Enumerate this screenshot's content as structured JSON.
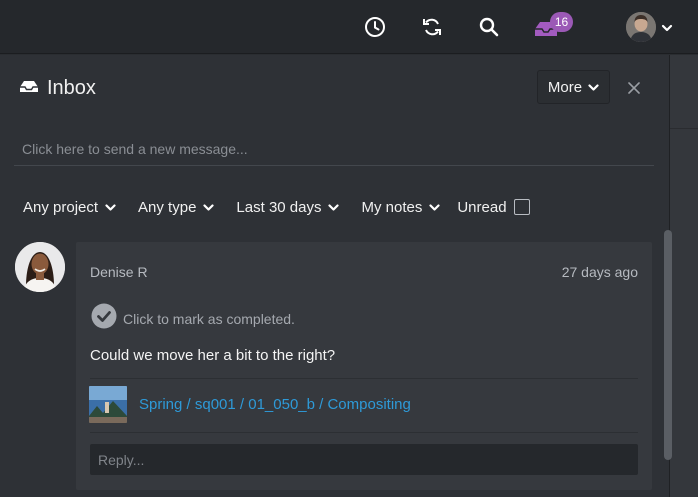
{
  "topbar": {
    "icons": [
      "clock-icon",
      "refresh-icon",
      "search-icon",
      "inbox-icon",
      "avatar",
      "chevron-down-icon"
    ],
    "inbox_badge": "16"
  },
  "inbox": {
    "title": "Inbox",
    "more_label": "More",
    "new_message_placeholder": "Click here to send a new message...",
    "filters": {
      "project": "Any project",
      "type": "Any type",
      "date": "Last 30 days",
      "notes": "My notes",
      "unread_label": "Unread",
      "unread_checked": false
    }
  },
  "message": {
    "author": "Denise R",
    "time": "27 days ago",
    "mark_completed": "Click to mark as completed.",
    "body": "Could we move her a bit to the right?",
    "entity_link": "Spring / sq001 / 01_050_b / Compositing",
    "reply_placeholder": "Reply..."
  },
  "colors": {
    "background": "#2e3136",
    "card": "#36393e",
    "link": "#2e9ad8",
    "badge": "#9b59b6"
  }
}
